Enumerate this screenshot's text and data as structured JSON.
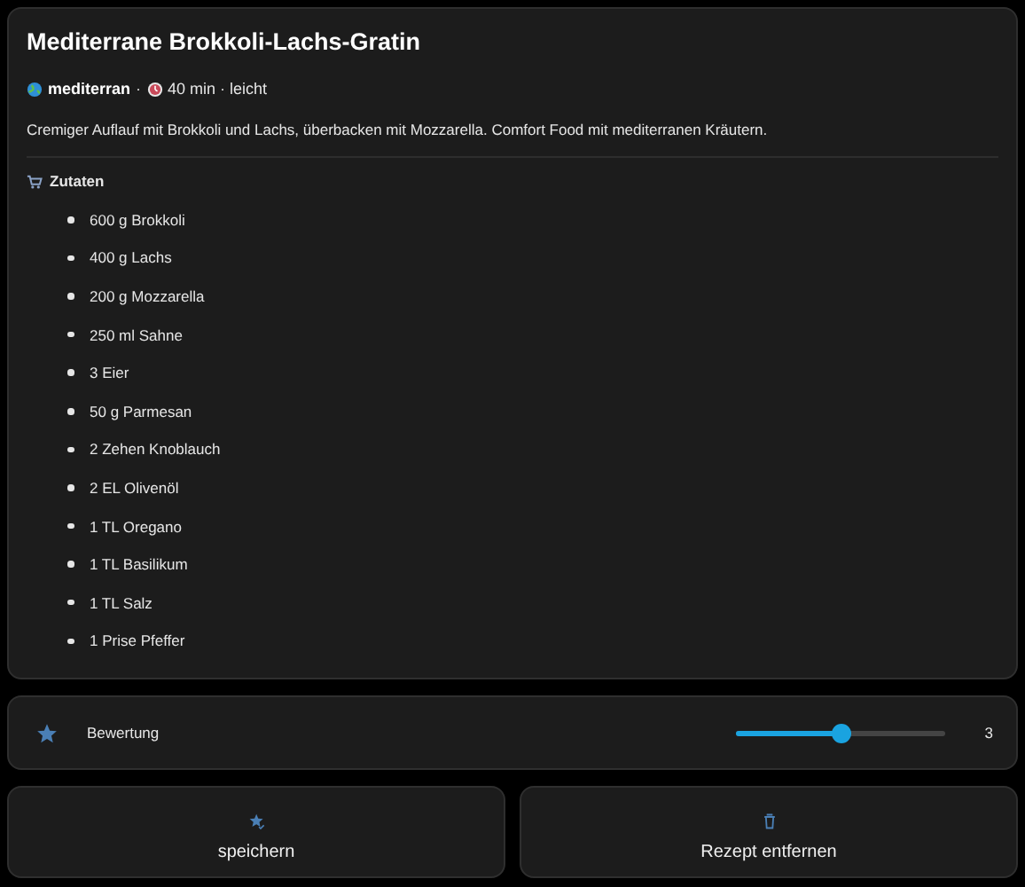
{
  "recipe": {
    "title": "Mediterrane Brokkoli-Lachs-Gratin",
    "meta": {
      "cuisine": "mediterran",
      "separator": "·",
      "details": "40 min · leicht"
    },
    "description": "Cremiger Auflauf mit Brokkoli und Lachs, überbacken mit Mozzarella. Comfort Food mit mediterranen Kräutern.",
    "ingredients_heading": "Zutaten",
    "ingredients": [
      "600 g Brokkoli",
      "400 g Lachs",
      "200 g Mozzarella",
      "250 ml Sahne",
      "3 Eier",
      "50 g Parmesan",
      "2 Zehen Knoblauch",
      "2 EL Olivenöl",
      "1 TL Oregano",
      "1 TL Basilikum",
      "1 TL Salz",
      "1 Prise Pfeffer"
    ]
  },
  "rating": {
    "label": "Bewertung",
    "level": 0.5,
    "value": "3"
  },
  "buttons": [
    {
      "kind": "save",
      "label": "speichern"
    },
    {
      "kind": "delete",
      "label": "Rezept entfernen"
    }
  ]
}
